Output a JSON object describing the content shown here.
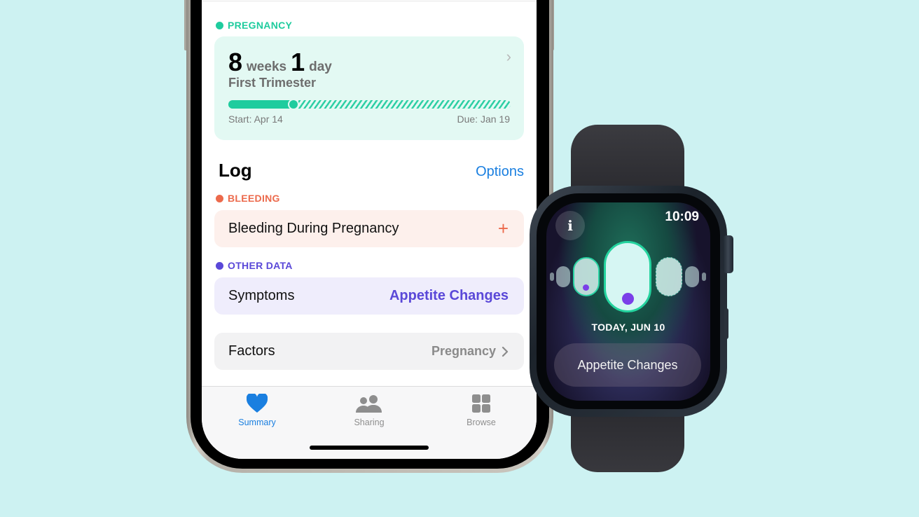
{
  "phone": {
    "pregnancy": {
      "section_label": "PREGNANCY",
      "weeks": "8",
      "weeks_unit": "weeks",
      "days": "1",
      "days_unit": "day",
      "trimester": "First Trimester",
      "progress_fraction": 0.23,
      "start_label": "Start: Apr 14",
      "due_label": "Due: Jan 19",
      "color": "#1fcc9e"
    },
    "log": {
      "title": "Log",
      "options_label": "Options",
      "bleeding": {
        "section_label": "BLEEDING",
        "row_label": "Bleeding During Pregnancy",
        "action": "+",
        "color": "#ec6a4c"
      },
      "other_data": {
        "section_label": "OTHER DATA",
        "row_label": "Symptoms",
        "row_value": "Appetite Changes",
        "color": "#5a48d8"
      },
      "factors": {
        "row_label": "Factors",
        "row_value": "Pregnancy"
      }
    },
    "tabbar": {
      "tabs": [
        {
          "label": "Summary",
          "icon": "heart-icon",
          "active": true
        },
        {
          "label": "Sharing",
          "icon": "people-icon",
          "active": false
        },
        {
          "label": "Browse",
          "icon": "grid-icon",
          "active": false
        }
      ],
      "accent": "#1a7fe0"
    }
  },
  "watch": {
    "info_icon": "i",
    "time": "10:09",
    "date_label": "TODAY, JUN 10",
    "symptom_button": "Appetite Changes"
  }
}
